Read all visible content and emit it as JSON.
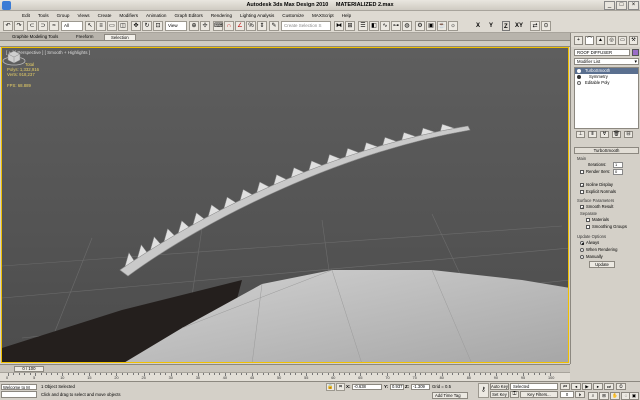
{
  "window": {
    "app_title": "Autodesk 3ds Max Design 2010",
    "file_name": "MATERIALIZED 2.max",
    "minimize": "_",
    "maximize": "□",
    "close": "×"
  },
  "menubar": [
    "Edit",
    "Tools",
    "Group",
    "Views",
    "Create",
    "Modifiers",
    "Animation",
    "Graph Editors",
    "Rendering",
    "Lighting Analysis",
    "Customize",
    "MAXScript",
    "Help"
  ],
  "toolbar": {
    "filter_value": "All",
    "refcoord_value": "View",
    "selset_placeholder": "Create Selection S",
    "axis_x": "X",
    "axis_y": "Y",
    "axis_z": "Z",
    "axis_xy": "XY"
  },
  "ribbon": {
    "tabs": [
      "Graphite Modeling Tools",
      "Freeform",
      "Selection"
    ]
  },
  "viewport": {
    "label": "[ + ] [ Perspective ] [ Smooth + Highlights ]",
    "stats_title": "Total",
    "polys": "Polys:    1,332,916",
    "verts": "Verts:    918,237",
    "fps": "FPS:    68.889"
  },
  "command_panel": {
    "tabs": [
      "+",
      "⌒",
      "▲",
      "◎",
      "▭",
      "⚒"
    ],
    "object_name": "ROOF DIFFUSER",
    "modifier_list": "Modifier List",
    "stack": [
      "TurboSmooth",
      "Symmetry",
      "Editable Poly"
    ],
    "turbosmooth": {
      "rollout": "TurboSmooth",
      "main_label": "Main",
      "iterations_label": "Iterations:",
      "iterations_value": "1",
      "render_iters_label": "Render Iters:",
      "render_iters_value": "0",
      "isoline": "Isoline Display",
      "explicit_normals": "Explicit Normals",
      "surface_params": "Surface Parameters",
      "smooth_result": "Smooth Result",
      "separate": "Separate",
      "materials": "Materials",
      "smoothing_groups": "Smoothing Groups",
      "update_options": "Update Options",
      "always": "Always",
      "when_rendering": "When Rendering",
      "manually": "Manually",
      "update_button": "Update"
    }
  },
  "timeline": {
    "slider": "0 / 100",
    "ticks": [
      "0",
      "5",
      "10",
      "15",
      "20",
      "25",
      "30",
      "35",
      "40",
      "45",
      "50",
      "55",
      "60",
      "65",
      "70",
      "75",
      "80",
      "85",
      "90",
      "95",
      "100"
    ]
  },
  "status": {
    "maxscript": "Welcome to M",
    "selected": "1 Object Selected",
    "prompt": "Click and drag to select and move objects",
    "x_label": "X:",
    "x_value": "-0.638",
    "y_label": "Y:",
    "y_value": "0.937",
    "z_label": "Z:",
    "z_value": "-1.309",
    "grid": "Grid = 0.5",
    "add_time_tag": "Add Time Tag",
    "auto_key": "Auto Key",
    "set_key": "Set Key",
    "selected_dd": "Selected",
    "key_filters": "Key Filters...",
    "frame": "0"
  },
  "colors": {
    "viewport_bg": "#585858",
    "active_border": "#f0c000",
    "stats_text": "#e8d066",
    "object_color": "#9a6cc8"
  }
}
